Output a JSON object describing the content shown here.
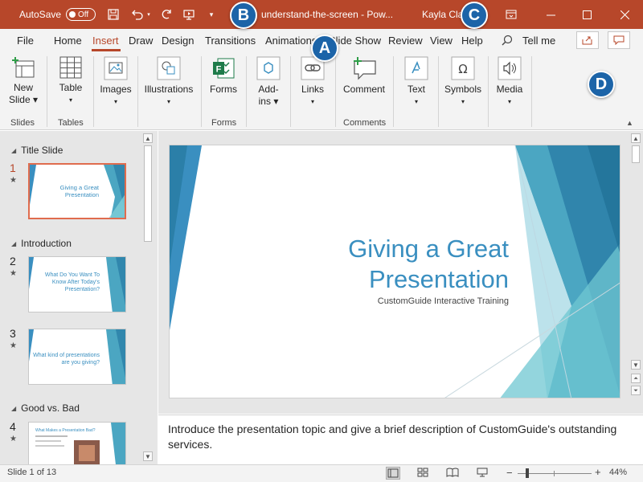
{
  "titlebar": {
    "autosave_label": "AutoSave",
    "autosave_state": "Off",
    "doc_title": "understand-the-screen - Pow...",
    "user_name": "Kayla Cla"
  },
  "badges": {
    "a": "A",
    "b": "B",
    "c": "C",
    "d": "D"
  },
  "tabs": [
    "File",
    "Home",
    "Insert",
    "Draw",
    "Design",
    "Transitions",
    "Animations",
    "Slide Show",
    "Review",
    "View",
    "Help"
  ],
  "tell_me": "Tell me",
  "ribbon": {
    "new_slide": [
      "New",
      "Slide"
    ],
    "table": "Table",
    "images": "Images",
    "illustrations": "Illustrations",
    "forms": "Forms",
    "addins": [
      "Add-",
      "ins"
    ],
    "links": "Links",
    "comment": "Comment",
    "text": "Text",
    "symbols": "Symbols",
    "media": "Media",
    "groups": [
      "Slides",
      "Tables",
      "Forms",
      "Comments"
    ]
  },
  "sections": [
    "Title Slide",
    "Introduction",
    "Good vs. Bad"
  ],
  "slides": [
    {
      "num": "1",
      "text": [
        "Giving a Great",
        "Presentation"
      ]
    },
    {
      "num": "2",
      "text": [
        "What Do You Want To",
        "Know After Today's",
        "Presentation?"
      ]
    },
    {
      "num": "3",
      "text": [
        "What kind of presentations",
        "are you giving?"
      ]
    },
    {
      "num": "4",
      "text": [
        "What Makes a Presentation Bad?"
      ]
    }
  ],
  "main_slide": {
    "title_line1": "Giving a Great",
    "title_line2": "Presentation",
    "subtitle": "CustomGuide Interactive Training"
  },
  "notes": "Introduce the presentation topic and give a brief description of CustomGuide's outstanding services.",
  "status": {
    "slide_count": "Slide 1 of 13",
    "zoom": "44%"
  },
  "colors": {
    "accent": "#b7472a",
    "badge": "#1c64a8",
    "slide_blue": "#3a8fc0",
    "teal": "#4bb3c7"
  }
}
